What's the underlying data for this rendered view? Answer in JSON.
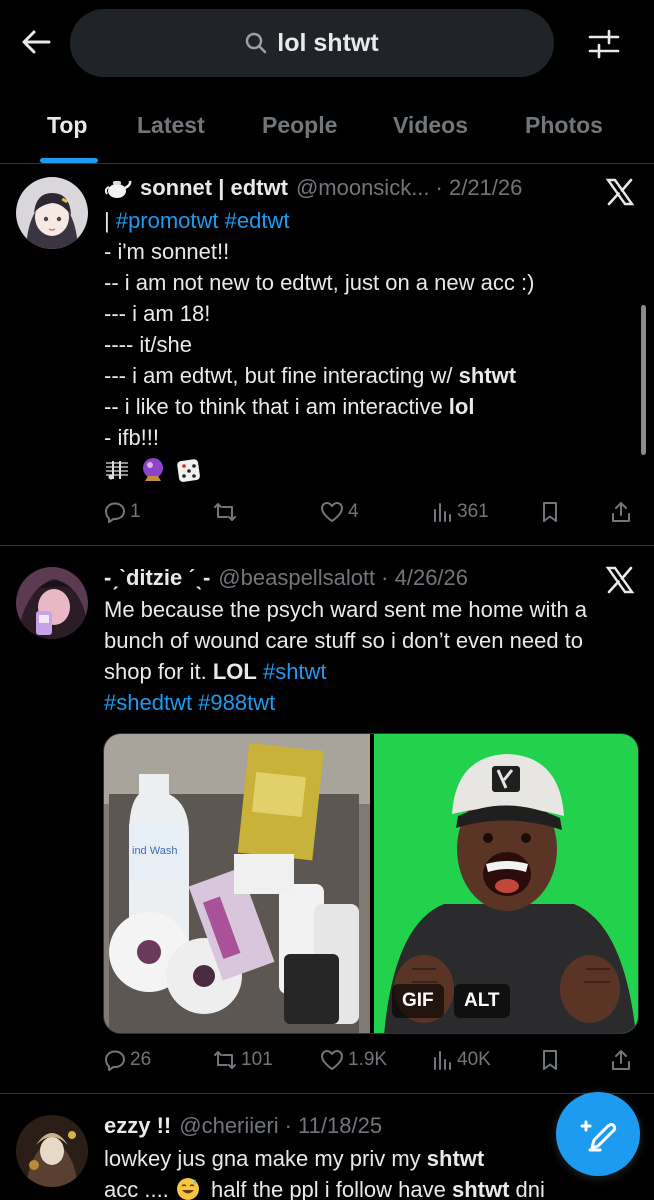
{
  "search": {
    "query": "lol shtwt"
  },
  "tabs": [
    {
      "label": "Top",
      "active": true
    },
    {
      "label": "Latest",
      "active": false
    },
    {
      "label": "People",
      "active": false
    },
    {
      "label": "Videos",
      "active": false
    },
    {
      "label": "Photos",
      "active": false
    }
  ],
  "posts": [
    {
      "name": "sonnet | edtwt",
      "handle": "@moonsick...",
      "date": "· 2/21/26",
      "hashtags": "#promotwt #edtwt",
      "lines": {
        "l1": "- i'm sonnet!!",
        "l2": "-- i am not new to edtwt, just on a new acc :)",
        "l3": "--- i am 18!",
        "l4": "---- it/she",
        "l5a": "--- i am edtwt, but fine interacting w/ ",
        "l5b": "shtwt",
        "l6a": "-- i like to think that i am interactive ",
        "l6b": "lol",
        "l7": "- ifb!!!"
      },
      "emoji_icons": [
        "musical-score-icon",
        "crystal-ball-icon",
        "game-die-icon"
      ],
      "stats": {
        "replies": "1",
        "reposts": "",
        "likes": "4",
        "views": "361"
      }
    },
    {
      "name": "-ˏˋditzie ˊˎ-",
      "handle": "@beaspellsalott",
      "date": "· 4/26/26",
      "text1": "Me because the psych ward sent me home with a bunch of wound care stuff so i don’t even need to shop for it. ",
      "bold1": "LOL",
      "tags1": " #shtwt",
      "tags2": "#shedtwt #988twt",
      "badges": {
        "gif": "GIF",
        "alt": "ALT"
      },
      "stats": {
        "replies": "26",
        "reposts": "101",
        "likes": "1.9K",
        "views": "40K"
      }
    },
    {
      "name": "ezzy !!",
      "handle": "@cheriieri",
      "date": "· 11/18/25",
      "line1a": "lowkey jus gna make my priv my ",
      "line1b": "shtwt",
      "line2a": "acc .... ",
      "line2b": " half the ppl i follow have ",
      "line2c": "shtwt",
      "line2d": " dni"
    }
  ],
  "colors": {
    "accent": "#1d9bf0",
    "muted": "#71767b",
    "text": "#e7e9ea",
    "background": "#000000"
  }
}
